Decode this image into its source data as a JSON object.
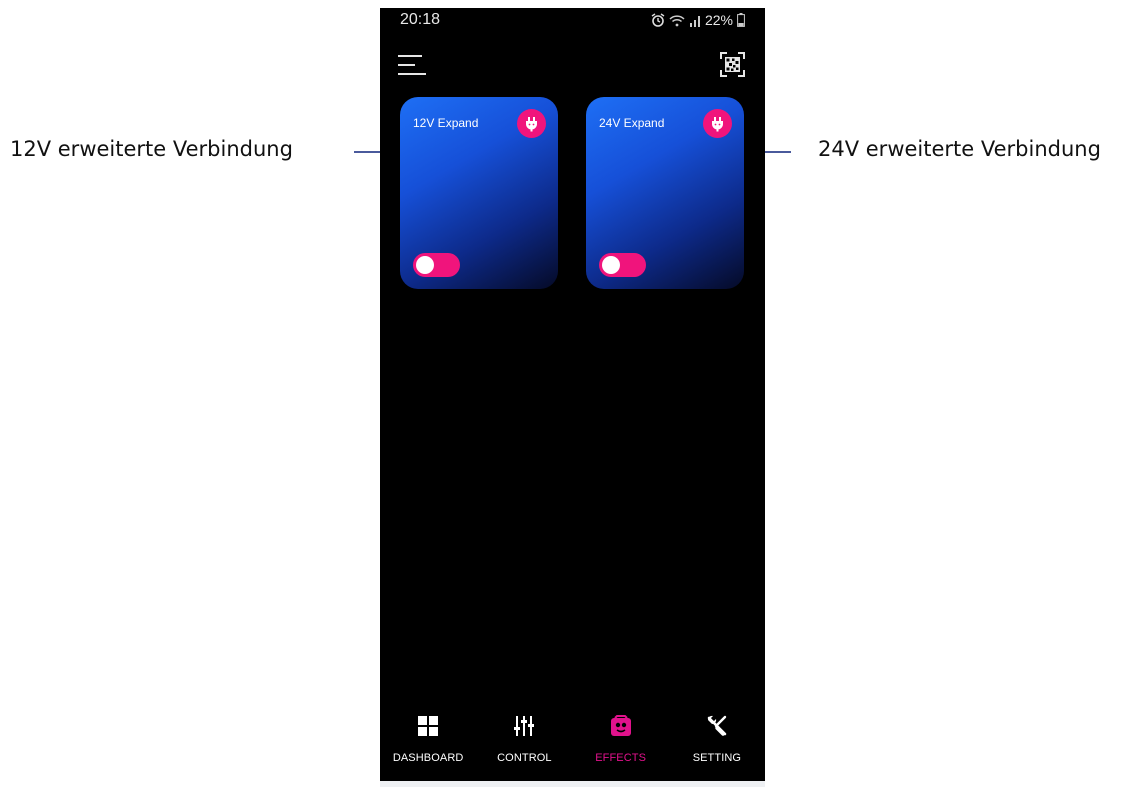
{
  "annotations": {
    "left": "12V erweiterte Verbindung",
    "right": "24V erweiterte Verbindung"
  },
  "status_bar": {
    "time": "20:18",
    "battery": "22%",
    "icons": [
      "alarm-icon",
      "wifi-icon",
      "signal-icon",
      "battery-icon"
    ]
  },
  "header": {
    "menu_icon": "menu-icon",
    "scan_icon": "qr-scan-icon"
  },
  "cards": [
    {
      "title": "12V Expand",
      "icon": "plug-icon",
      "toggle_on": true
    },
    {
      "title": "24V Expand",
      "icon": "plug-icon",
      "toggle_on": true
    }
  ],
  "tabs": [
    {
      "label": "DASHBOARD",
      "icon": "dashboard-grid-icon",
      "active": false
    },
    {
      "label": "CONTROL",
      "icon": "sliders-icon",
      "active": false
    },
    {
      "label": "EFFECTS",
      "icon": "effects-icon",
      "active": true
    },
    {
      "label": "SETTING",
      "icon": "tools-icon",
      "active": false
    }
  ],
  "colors": {
    "accent": "#f0147c",
    "active_tab": "#e1128c",
    "card_top": "#1e6ff5",
    "card_bottom": "#050a26",
    "wave_pink": "#e35cd4",
    "wave_cyan": "#22d3f5",
    "background": "#000000"
  }
}
